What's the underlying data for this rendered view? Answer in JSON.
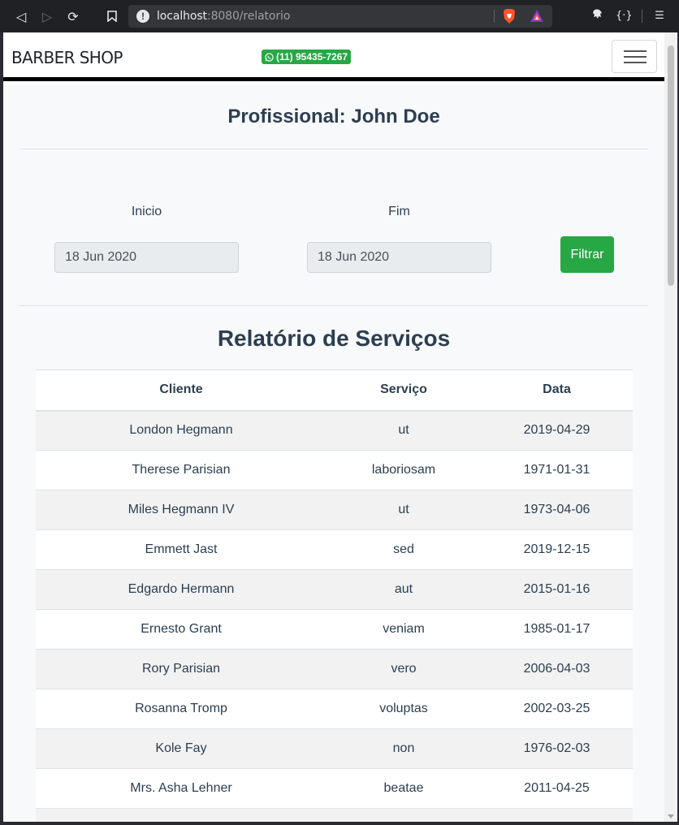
{
  "browser": {
    "url_host": "localhost",
    "url_rest": ":8080/relatorio"
  },
  "navbar": {
    "brand": "BARBER SHOP",
    "whatsapp": "(11) 95435-7267"
  },
  "profile": {
    "label": "Profissional:",
    "name": "John Doe"
  },
  "filter": {
    "start_label": "Inicio",
    "start_value": "18 Jun 2020",
    "end_label": "Fim",
    "end_value": "18 Jun 2020",
    "button": "Filtrar"
  },
  "report": {
    "title": "Relatório de Serviços",
    "columns": [
      "Cliente",
      "Serviço",
      "Data"
    ],
    "rows": [
      [
        "London Hegmann",
        "ut",
        "2019-04-29"
      ],
      [
        "Therese Parisian",
        "laboriosam",
        "1971-01-31"
      ],
      [
        "Miles Hegmann IV",
        "ut",
        "1973-04-06"
      ],
      [
        "Emmett Jast",
        "sed",
        "2019-12-15"
      ],
      [
        "Edgardo Hermann",
        "aut",
        "2015-01-16"
      ],
      [
        "Ernesto Grant",
        "veniam",
        "1985-01-17"
      ],
      [
        "Rory Parisian",
        "vero",
        "2006-04-03"
      ],
      [
        "Rosanna Tromp",
        "voluptas",
        "2002-03-25"
      ],
      [
        "Kole Fay",
        "non",
        "1976-02-03"
      ],
      [
        "Mrs. Asha Lehner",
        "beatae",
        "2011-04-25"
      ],
      [
        "",
        "",
        ""
      ]
    ]
  },
  "colors": {
    "success": "#28a745",
    "text": "#2c3e50",
    "chrome": "#202124"
  }
}
